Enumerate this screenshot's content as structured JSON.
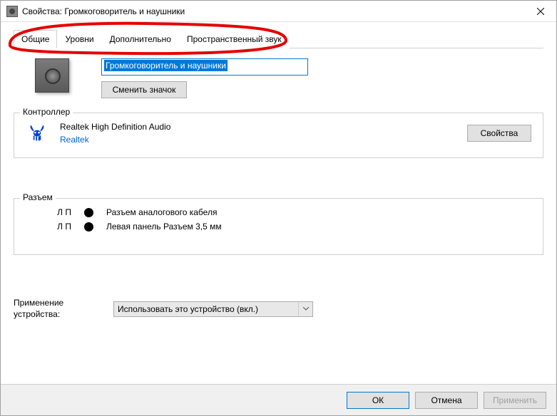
{
  "window": {
    "title": "Свойства: Громкоговоритель и наушники"
  },
  "tabs": {
    "general": "Общие",
    "levels": "Уровни",
    "advanced": "Дополнительно",
    "spatial": "Пространственный звук"
  },
  "device": {
    "name_value": "Громкоговоритель и наушники",
    "change_icon_btn": "Сменить значок"
  },
  "controller": {
    "group_title": "Контроллер",
    "name": "Realtek High Definition Audio",
    "vendor": "Realtek",
    "properties_btn": "Свойства"
  },
  "jack": {
    "group_title": "Разъем",
    "rows": [
      {
        "lr": "Л П",
        "label": "Разъем аналогового кабеля"
      },
      {
        "lr": "Л П",
        "label": "Левая панель Разъем 3,5 мм"
      }
    ]
  },
  "usage": {
    "label": "Применение устройства:",
    "selected": "Использовать это устройство (вкл.)"
  },
  "footer": {
    "ok": "ОК",
    "cancel": "Отмена",
    "apply": "Применить"
  }
}
